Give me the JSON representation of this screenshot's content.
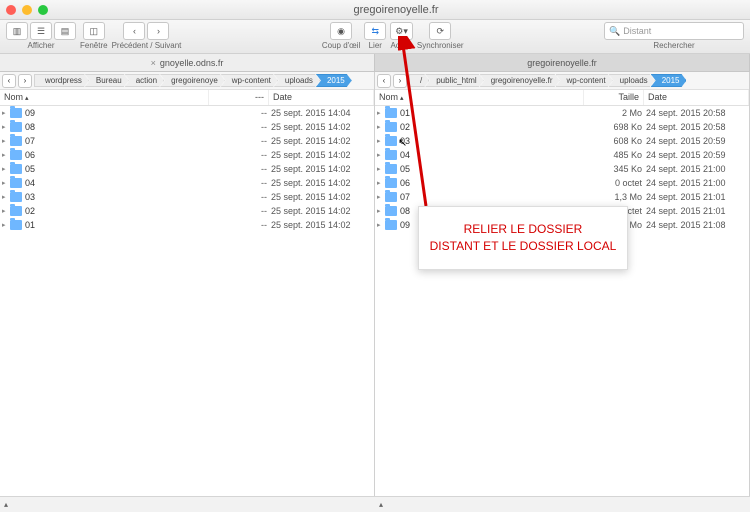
{
  "window": {
    "title": "gregoirenoyelle.fr"
  },
  "toolbar": {
    "afficher": "Afficher",
    "fenetre": "Fenêtre",
    "nav": "Précédent / Suivant",
    "coup": "Coup d'œil",
    "lier": "Lier",
    "action": "Action",
    "sync": "Synchroniser",
    "search_label": "Rechercher",
    "search_placeholder": "Distant"
  },
  "tabs": [
    {
      "label": "gnoyelle.odns.fr",
      "active": false
    },
    {
      "label": "gregoirenoyelle.fr",
      "active": true
    }
  ],
  "left": {
    "crumbs": [
      "wordpress",
      "Bureau",
      "action",
      "gregoirenoye",
      "wp-content",
      "uploads",
      "2015"
    ],
    "dropdown": "•",
    "headers": {
      "name": "Nom",
      "size": "---",
      "date": "Date"
    },
    "rows": [
      {
        "n": "09",
        "s": "--",
        "d": "25 sept. 2015 14:04"
      },
      {
        "n": "08",
        "s": "--",
        "d": "25 sept. 2015 14:02"
      },
      {
        "n": "07",
        "s": "--",
        "d": "25 sept. 2015 14:02"
      },
      {
        "n": "06",
        "s": "--",
        "d": "25 sept. 2015 14:02"
      },
      {
        "n": "05",
        "s": "--",
        "d": "25 sept. 2015 14:02"
      },
      {
        "n": "04",
        "s": "--",
        "d": "25 sept. 2015 14:02"
      },
      {
        "n": "03",
        "s": "--",
        "d": "25 sept. 2015 14:02"
      },
      {
        "n": "02",
        "s": "--",
        "d": "25 sept. 2015 14:02"
      },
      {
        "n": "01",
        "s": "--",
        "d": "25 sept. 2015 14:02"
      }
    ]
  },
  "right": {
    "crumbs": [
      "/",
      "public_html",
      "gregoirenoyelle.fr",
      "wp-content",
      "uploads",
      "2015"
    ],
    "headers": {
      "name": "Nom",
      "size": "Taille",
      "date": "Date"
    },
    "rows": [
      {
        "n": "01",
        "s": "2 Mo",
        "d": "24 sept. 2015 20:58"
      },
      {
        "n": "02",
        "s": "698 Ko",
        "d": "24 sept. 2015 20:58"
      },
      {
        "n": "03",
        "s": "608 Ko",
        "d": "24 sept. 2015 20:59"
      },
      {
        "n": "04",
        "s": "485 Ko",
        "d": "24 sept. 2015 20:59"
      },
      {
        "n": "05",
        "s": "345 Ko",
        "d": "24 sept. 2015 21:00"
      },
      {
        "n": "06",
        "s": "0 octet",
        "d": "24 sept. 2015 21:00"
      },
      {
        "n": "07",
        "s": "1,3 Mo",
        "d": "24 sept. 2015 21:01"
      },
      {
        "n": "08",
        "s": "0 octet",
        "d": "24 sept. 2015 21:01"
      },
      {
        "n": "09",
        "s": "13 Mo",
        "d": "24 sept. 2015 21:08"
      }
    ]
  },
  "callout": {
    "line1": "RELIER LE DOSSIER",
    "line2": "DISTANT ET LE DOSSIER LOCAL"
  }
}
